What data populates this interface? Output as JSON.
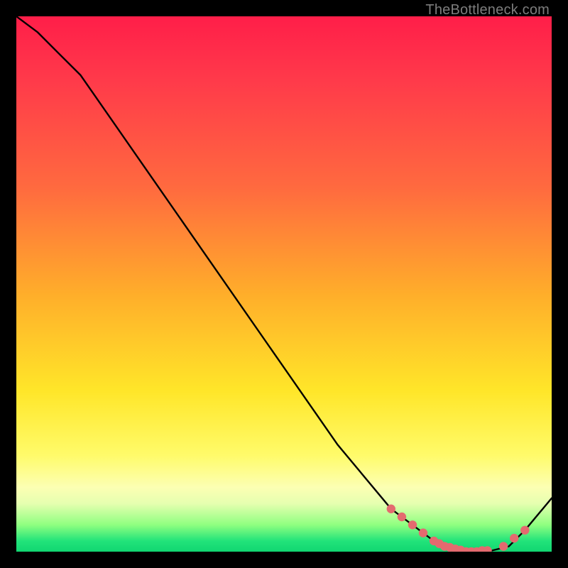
{
  "watermark": "TheBottleneck.com",
  "colors": {
    "background": "#000000",
    "gradient_top": "#ff1e49",
    "gradient_mid": "#ffe629",
    "gradient_bottom": "#11d671",
    "curve": "#000000",
    "marker": "#e46a6f"
  },
  "chart_data": {
    "type": "line",
    "title": "",
    "xlabel": "",
    "ylabel": "",
    "xlim": [
      0,
      100
    ],
    "ylim": [
      0,
      100
    ],
    "series": [
      {
        "name": "bottleneck-curve",
        "x": [
          0,
          4,
          8,
          12,
          60,
          70,
          78,
          84,
          88,
          92,
          95,
          100
        ],
        "y": [
          100,
          97,
          93,
          89,
          20,
          8,
          2,
          0,
          0,
          1,
          4,
          10
        ]
      }
    ],
    "markers": {
      "name": "highlight-points",
      "x": [
        70,
        72,
        74,
        76,
        78,
        79,
        80,
        81,
        82,
        83,
        84,
        85,
        86,
        87,
        88,
        91,
        93,
        95
      ],
      "y": [
        8,
        6.5,
        5,
        3.5,
        2,
        1.5,
        1,
        0.8,
        0.5,
        0.3,
        0,
        0,
        0,
        0.2,
        0.2,
        1,
        2.5,
        4
      ]
    }
  }
}
